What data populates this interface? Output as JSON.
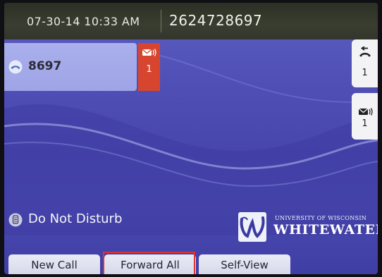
{
  "header": {
    "datetime": "07-30-14 10:33 AM",
    "phone_number": "2624728697"
  },
  "line": {
    "label": "8697",
    "icon": "handset-icon",
    "voicemail_count": "1"
  },
  "side_keys": {
    "recent_calls": {
      "icon": "recent-calls-icon",
      "count": "1"
    },
    "voicemail": {
      "icon": "voicemail-icon",
      "count": "1"
    }
  },
  "dnd": {
    "label": "Do Not Disturb",
    "icon": "dnd-icon"
  },
  "logo": {
    "subtitle": "UNIVERSITY OF WISCONSIN",
    "title": "WHITEWATER"
  },
  "softkeys": {
    "new_call": "New Call",
    "forward_all": "Forward All",
    "self_view": "Self-View"
  },
  "colors": {
    "background": "#4f4fb6",
    "header": "#33362b",
    "line_button": "#aab0ec",
    "voicemail_badge": "#d8452f",
    "highlight": "#e03333"
  }
}
